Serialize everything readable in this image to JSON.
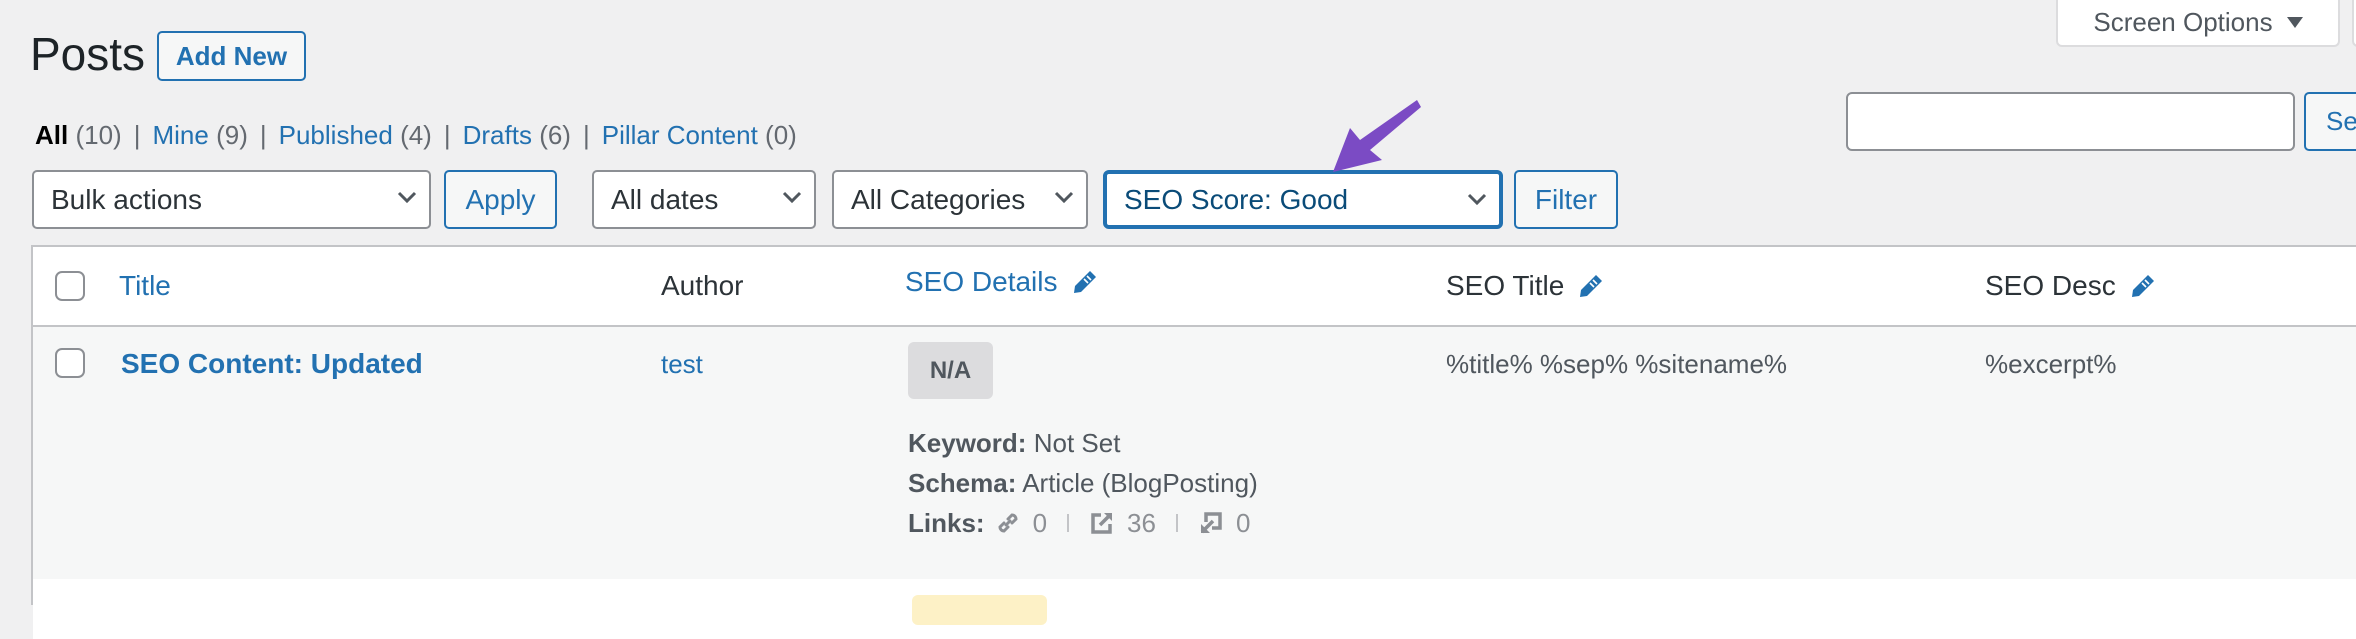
{
  "header": {
    "title": "Posts",
    "add_new_label": "Add New",
    "screen_options_label": "Screen Options"
  },
  "views": [
    {
      "label": "All",
      "count": "(10)",
      "current": true
    },
    {
      "label": "Mine",
      "count": "(9)",
      "current": false
    },
    {
      "label": "Published",
      "count": "(4)",
      "current": false
    },
    {
      "label": "Drafts",
      "count": "(6)",
      "current": false
    },
    {
      "label": "Pillar Content",
      "count": "(0)",
      "current": false
    }
  ],
  "views_separator": "|",
  "search": {
    "value": "",
    "placeholder": "",
    "button_label": "Se"
  },
  "toolbar": {
    "bulk_actions": "Bulk actions",
    "apply_label": "Apply",
    "dates": "All dates",
    "categories": "All Categories",
    "seo_score": "SEO Score: Good",
    "filter_label": "Filter"
  },
  "table": {
    "columns": {
      "title": "Title",
      "author": "Author",
      "seo_details": "SEO Details",
      "seo_title": "SEO Title",
      "seo_desc": "SEO Desc"
    },
    "rows": [
      {
        "title": "SEO Content: Updated",
        "author": "test",
        "seo_score": "N/A",
        "keyword_label": "Keyword:",
        "keyword_value": "Not Set",
        "schema_label": "Schema:",
        "schema_value": "Article (BlogPosting)",
        "links_label": "Links:",
        "internal_links": "0",
        "external_links": "36",
        "incoming_links": "0",
        "seo_title": "%title% %sep% %sitename%",
        "seo_desc": "%excerpt%"
      }
    ]
  },
  "colors": {
    "accent": "#2271b1",
    "annotation_arrow": "#7b4bc4",
    "row_alt_bg": "#f6f7f7",
    "page_bg": "#f0f0f1"
  }
}
